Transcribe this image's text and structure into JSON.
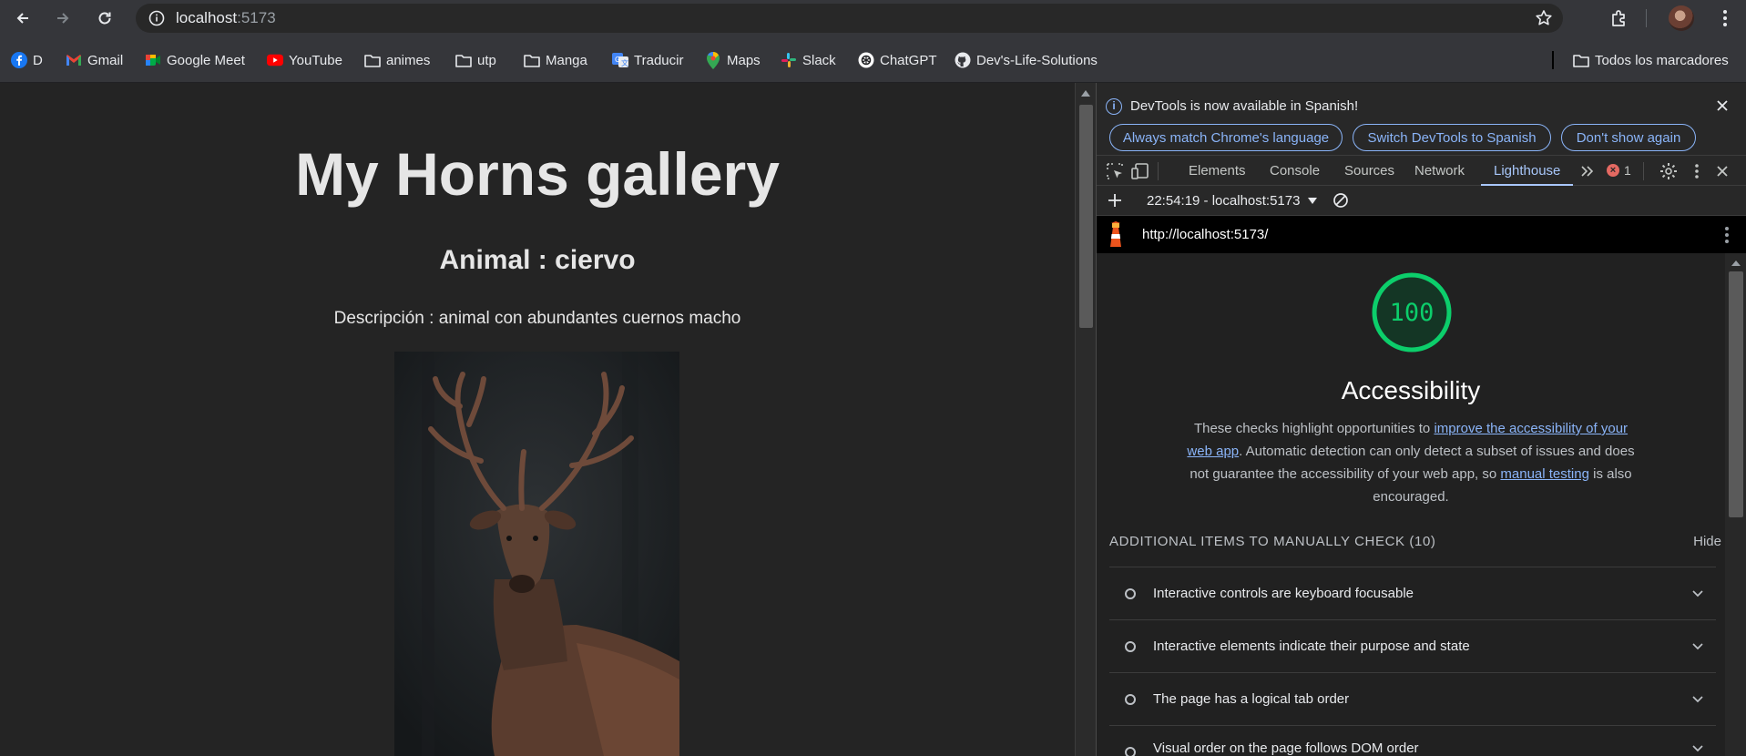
{
  "browser": {
    "url_host": "localhost",
    "url_port": ":5173"
  },
  "bookmarks": [
    {
      "label": "D",
      "icon": "facebook-icon"
    },
    {
      "label": "Gmail",
      "icon": "gmail-icon"
    },
    {
      "label": "Google Meet",
      "icon": "google-meet-icon"
    },
    {
      "label": "YouTube",
      "icon": "youtube-icon"
    },
    {
      "label": "animes",
      "icon": "folder-icon"
    },
    {
      "label": "utp",
      "icon": "folder-icon"
    },
    {
      "label": "Manga",
      "icon": "folder-icon"
    },
    {
      "label": "Traducir",
      "icon": "translate-icon"
    },
    {
      "label": "Maps",
      "icon": "maps-icon"
    },
    {
      "label": "Slack",
      "icon": "slack-icon"
    },
    {
      "label": "ChatGPT",
      "icon": "chatgpt-icon"
    },
    {
      "label": "Dev's-Life-Solutions",
      "icon": "github-icon"
    }
  ],
  "all_bookmarks_label": "Todos los marcadores",
  "page": {
    "title": "My Horns gallery",
    "animal": "Animal : ciervo",
    "description": "Descripción : animal con abundantes cuernos macho"
  },
  "devtools": {
    "infobar": {
      "message": "DevTools is now available in Spanish!",
      "btn_match": "Always match Chrome's language",
      "btn_switch": "Switch DevTools to Spanish",
      "btn_dont_show": "Don't show again"
    },
    "tabs": [
      "Elements",
      "Console",
      "Sources",
      "Network",
      "Lighthouse"
    ],
    "active_tab": "Lighthouse",
    "error_count": "1",
    "report_selector": "22:54:19 - localhost:5173",
    "report_url": "http://localhost:5173/",
    "lighthouse": {
      "score": "100",
      "score_fraction": 1.0,
      "score_color": "#0cce6b",
      "category": "Accessibility",
      "desc_1": "These checks highlight opportunities to ",
      "link_1": "improve the accessibility of your web app",
      "desc_2": ". Automatic detection can only detect a subset of issues and does not guarantee the accessibility of your web app, so ",
      "link_2": "manual testing",
      "desc_3": " is also encouraged.",
      "manual_heading": "ADDITIONAL ITEMS TO MANUALLY CHECK (10)",
      "hide_label": "Hide",
      "audits": [
        "Interactive controls are keyboard focusable",
        "Interactive elements indicate their purpose and state",
        "The page has a logical tab order",
        "Visual order on the page follows DOM order"
      ]
    }
  }
}
